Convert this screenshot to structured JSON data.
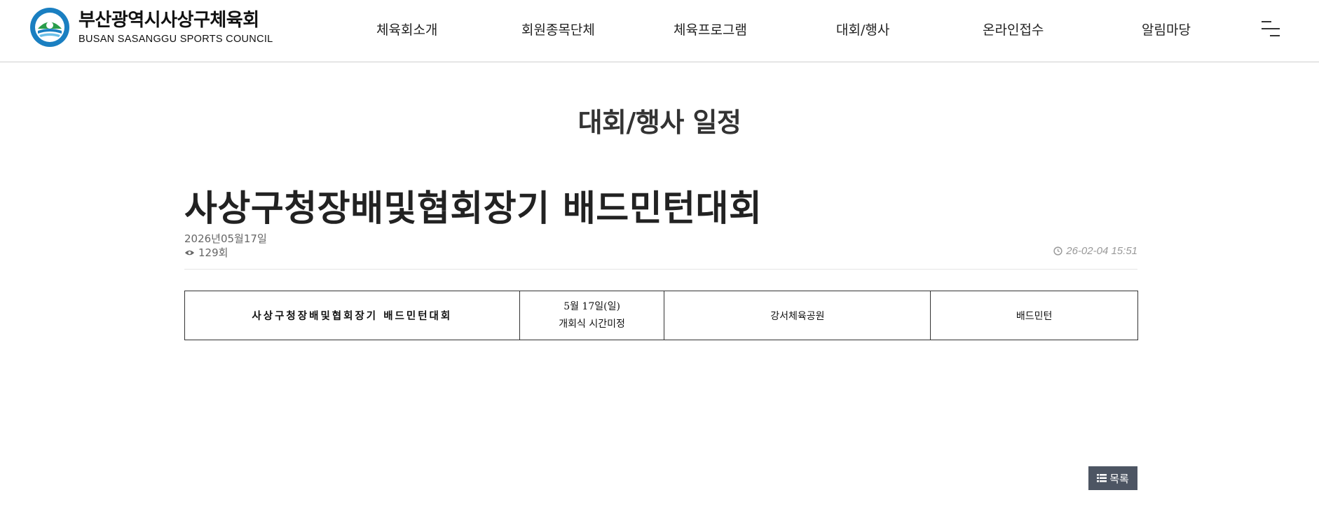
{
  "header": {
    "logo": {
      "name_ko": "부산광역시사상구체육회",
      "name_en": "BUSAN SASANGGU SPORTS COUNCIL"
    },
    "nav": [
      {
        "label": "체육회소개"
      },
      {
        "label": "회원종목단체"
      },
      {
        "label": "체육프로그램"
      },
      {
        "label": "대회/행사"
      },
      {
        "label": "온라인접수"
      },
      {
        "label": "알림마당"
      }
    ],
    "menu_icon": "hamburger-menu-icon"
  },
  "page": {
    "title": "대회/행사 일정"
  },
  "post": {
    "subject": "사상구청장배및협회장기 배드민턴대회",
    "event_date": "2026년05월17일",
    "views": "129회",
    "written_at": "26-02-04 15:51",
    "view_icon": "eye-icon",
    "time_icon": "clock-icon"
  },
  "table": {
    "event_name": "사상구청장배및협회장기 배드민턴대회",
    "date_line1": "5월 17일(일)",
    "date_line2": "개회식 시간미정",
    "venue": "강서체육공원",
    "sport": "배드민턴"
  },
  "buttons": {
    "list_label": "목록",
    "list_icon": "list-icon"
  },
  "colors": {
    "button_bg": "#4d5563",
    "header_border": "#cfcfcf",
    "emblem_blue": "#1a7fc1",
    "emblem_green": "#2a9d4a"
  }
}
